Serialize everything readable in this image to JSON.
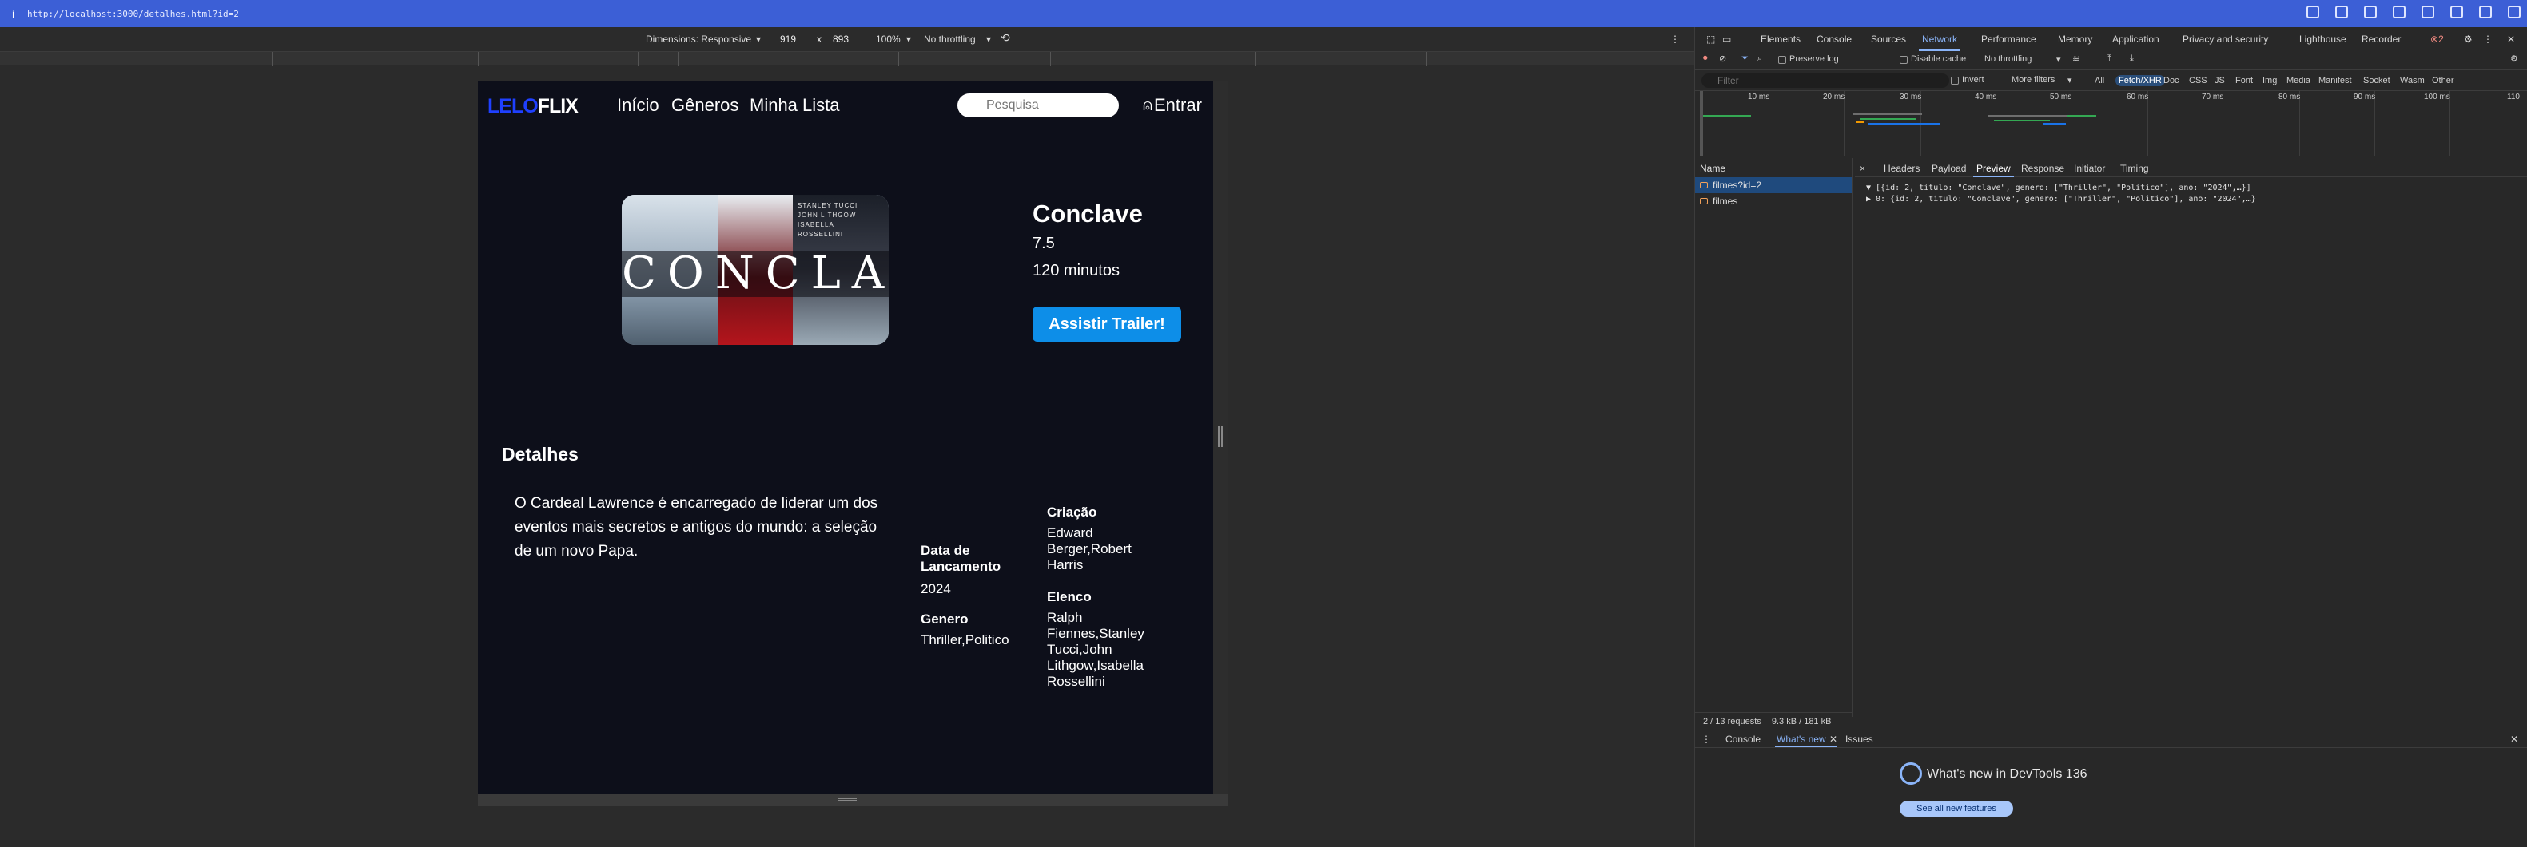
{
  "browser": {
    "url": "http://localhost:3000/detalhes.html?id=2",
    "info_icon": "i"
  },
  "device_toolbar": {
    "dimensions_label": "Dimensions: Responsive",
    "width": "919",
    "times": "x",
    "height": "893",
    "zoom": "100%",
    "throttling": "No throttling"
  },
  "site": {
    "logo_blue": "LELO",
    "logo_white": "FLIX",
    "nav": [
      "Início",
      "Gêneros",
      "Minha Lista"
    ],
    "search_placeholder": "Pesquisa",
    "login": "Entrar"
  },
  "movie": {
    "title": "Conclave",
    "rating": "7.5",
    "duration": "120 minutos",
    "trailer_button": "Assistir Trailer!",
    "poster_title": "CONCLAVE",
    "poster_credits": [
      "STANLEY TUCCI",
      "JOHN LITHGOW",
      "ISABELLA ROSSELLINI"
    ],
    "details_heading": "Detalhes",
    "synopsis": "O Cardeal Lawrence é encarregado de liderar um dos eventos mais secretos e antigos do mundo: a seleção de um novo Papa.",
    "release_label": "Data de Lancamento",
    "release_value": "2024",
    "genre_label": "Genero",
    "genre_value": "Thriller,Politico",
    "creation_label": "Criação",
    "creation_value": "Edward Berger,Robert Harris",
    "cast_label": "Elenco",
    "cast_value": "Ralph Fiennes,Stanley Tucci,John Lithgow,Isabella Rossellini"
  },
  "devtools": {
    "tabs": [
      "Elements",
      "Console",
      "Sources",
      "Network",
      "Performance",
      "Memory",
      "Application",
      "Privacy and security",
      "Lighthouse",
      "Recorder"
    ],
    "active_tab": "Network",
    "error_count": "2",
    "toolbar": {
      "preserve_log": "Preserve log",
      "disable_cache": "Disable cache",
      "throttling": "No throttling"
    },
    "filter": {
      "placeholder": "Filter",
      "invert": "Invert",
      "more_filters": "More filters",
      "types": [
        "All",
        "Fetch/XHR",
        "Doc",
        "CSS",
        "JS",
        "Font",
        "Img",
        "Media",
        "Manifest",
        "Socket",
        "Wasm",
        "Other"
      ],
      "active_type": "Fetch/XHR"
    },
    "timeline_labels": [
      "10 ms",
      "20 ms",
      "30 ms",
      "40 ms",
      "50 ms",
      "60 ms",
      "70 ms",
      "80 ms",
      "90 ms",
      "100 ms",
      "110"
    ],
    "requests_header": "Name",
    "requests": [
      "filmes?id=2",
      "filmes"
    ],
    "selected_request": "filmes?id=2",
    "footer_requests": "2 / 13 requests",
    "footer_size": "9.3 kB / 181 kB",
    "detail_tabs": [
      "Headers",
      "Payload",
      "Preview",
      "Response",
      "Initiator",
      "Timing"
    ],
    "active_detail_tab": "Preview",
    "close_icon": "×",
    "preview_lines": [
      "▼ [{id: 2, titulo: \"Conclave\", genero: [\"Thriller\", \"Politico\"], ano: \"2024\",…}]",
      "  ▶ 0: {id: 2, titulo: \"Conclave\", genero: [\"Thriller\", \"Politico\"], ano: \"2024\",…}"
    ],
    "drawer": {
      "tabs": [
        "Console",
        "What's new",
        "Issues"
      ],
      "active_tab": "What's new",
      "title": "What's new in DevTools 136",
      "button": "See all new features"
    }
  },
  "colors": {
    "address_bar": "#3c5fd6",
    "page_bg": "#0d0f1a",
    "logo_blue": "#1f40ff",
    "trailer_button": "#0d8ee8",
    "devtools_bg": "#282828",
    "accent": "#8ab4f8"
  }
}
